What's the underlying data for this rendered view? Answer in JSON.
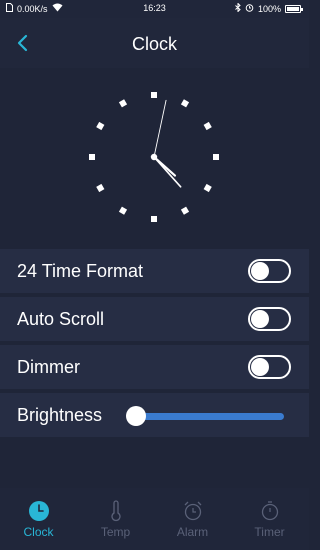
{
  "status_bar": {
    "speed": "0.00K/s",
    "time": "16:23",
    "battery": "100%"
  },
  "header": {
    "title": "Clock"
  },
  "clock": {
    "hour": 4,
    "minute": 23,
    "second": 2
  },
  "settings": {
    "time_format_label": "24 Time Format",
    "time_format_on": false,
    "auto_scroll_label": "Auto Scroll",
    "auto_scroll_on": false,
    "dimmer_label": "Dimmer",
    "dimmer_on": false,
    "brightness_label": "Brightness",
    "brightness_level": 0
  },
  "tabs": [
    {
      "label": "Clock",
      "icon": "clock-icon",
      "active": true
    },
    {
      "label": "Temp",
      "icon": "thermometer-icon",
      "active": false
    },
    {
      "label": "Alarm",
      "icon": "alarm-icon",
      "active": false
    },
    {
      "label": "Timer",
      "icon": "stopwatch-icon",
      "active": false
    }
  ],
  "colors": {
    "accent": "#29b6d6",
    "slider": "#3a7bcf",
    "tab_inactive": "#5a6178"
  }
}
